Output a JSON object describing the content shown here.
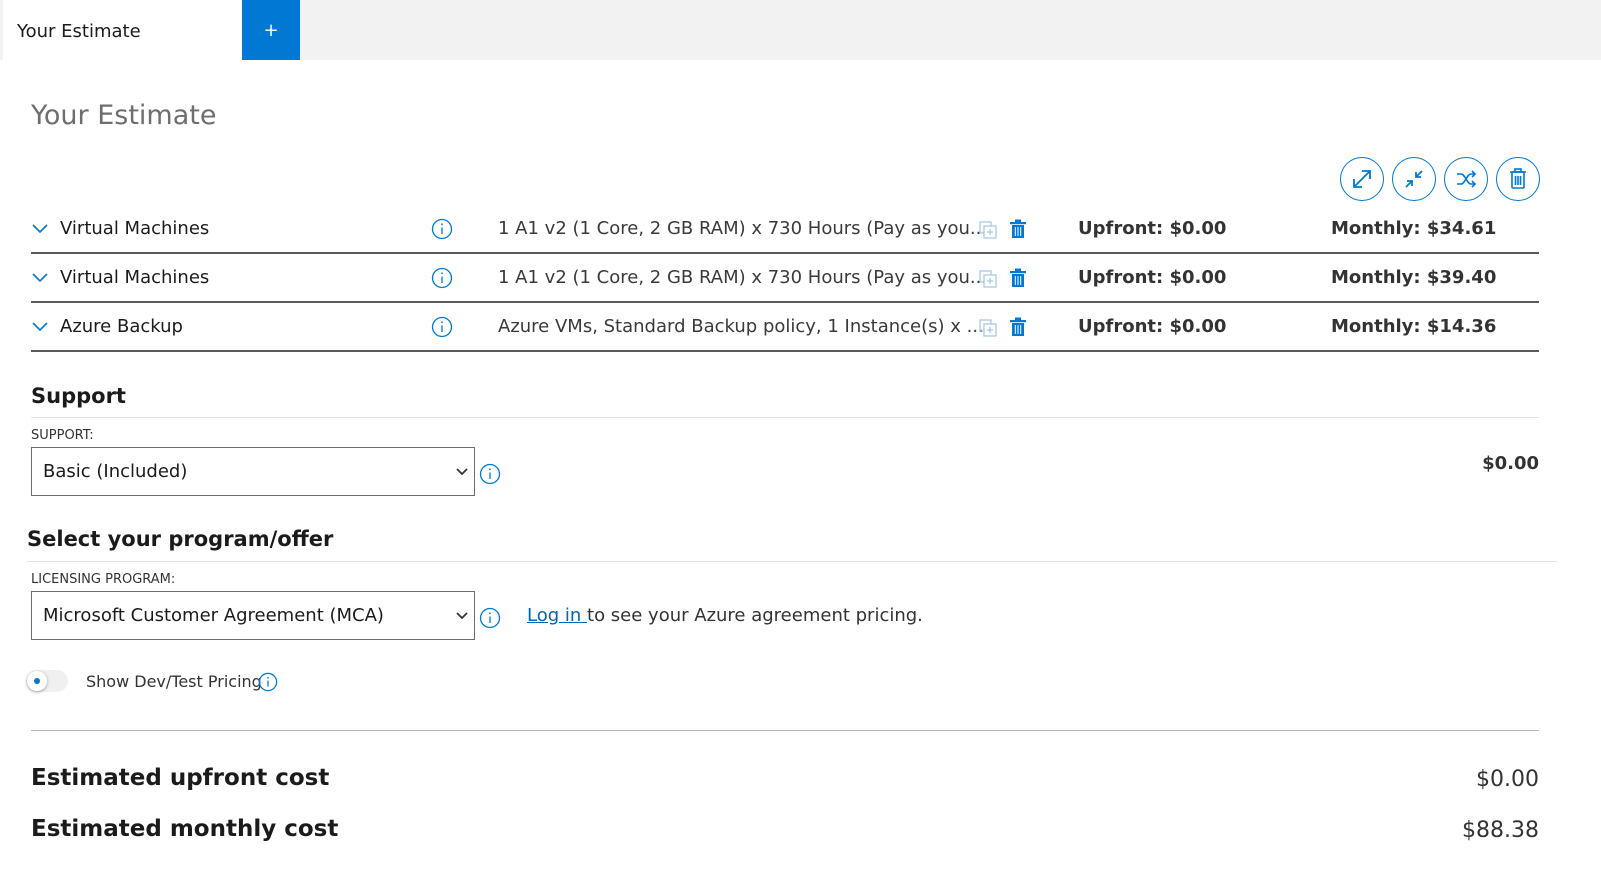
{
  "tabs": {
    "active_label": "Your Estimate",
    "add_label": "+"
  },
  "page_title": "Your Estimate",
  "toolbar_icons": [
    "expand-icon",
    "collapse-icon",
    "shuffle-icon",
    "trash-icon"
  ],
  "estimate_rows": [
    {
      "service": "Virtual Machines",
      "description": "1 A1 v2 (1 Core, 2 GB RAM) x 730 Hours (Pay as you...",
      "upfront": "Upfront: $0.00",
      "monthly": "Monthly: $34.61"
    },
    {
      "service": "Virtual Machines",
      "description": "1 A1 v2 (1 Core, 2 GB RAM) x 730 Hours (Pay as you...",
      "upfront": "Upfront: $0.00",
      "monthly": "Monthly: $39.40"
    },
    {
      "service": "Azure Backup",
      "description": "Azure VMs, Standard Backup policy, 1 Instance(s) x ...",
      "upfront": "Upfront: $0.00",
      "monthly": "Monthly: $14.36"
    }
  ],
  "support": {
    "title": "Support",
    "field_label": "SUPPORT:",
    "selected": "Basic (Included)",
    "price": "$0.00"
  },
  "program": {
    "title": "Select your program/offer",
    "field_label": "LICENSING PROGRAM:",
    "selected": "Microsoft Customer Agreement (MCA)",
    "login_link": "Log in ",
    "login_text": "to see your Azure agreement pricing."
  },
  "dev_test": {
    "label": "Show Dev/Test Pricing",
    "enabled": false
  },
  "totals": {
    "upfront_label": "Estimated upfront cost",
    "upfront_value": "$0.00",
    "monthly_label": "Estimated monthly cost",
    "monthly_value": "$88.38"
  },
  "colors": {
    "accent": "#0078d4",
    "link": "#0065b3",
    "tabbar_bg": "#f2f2f2"
  }
}
